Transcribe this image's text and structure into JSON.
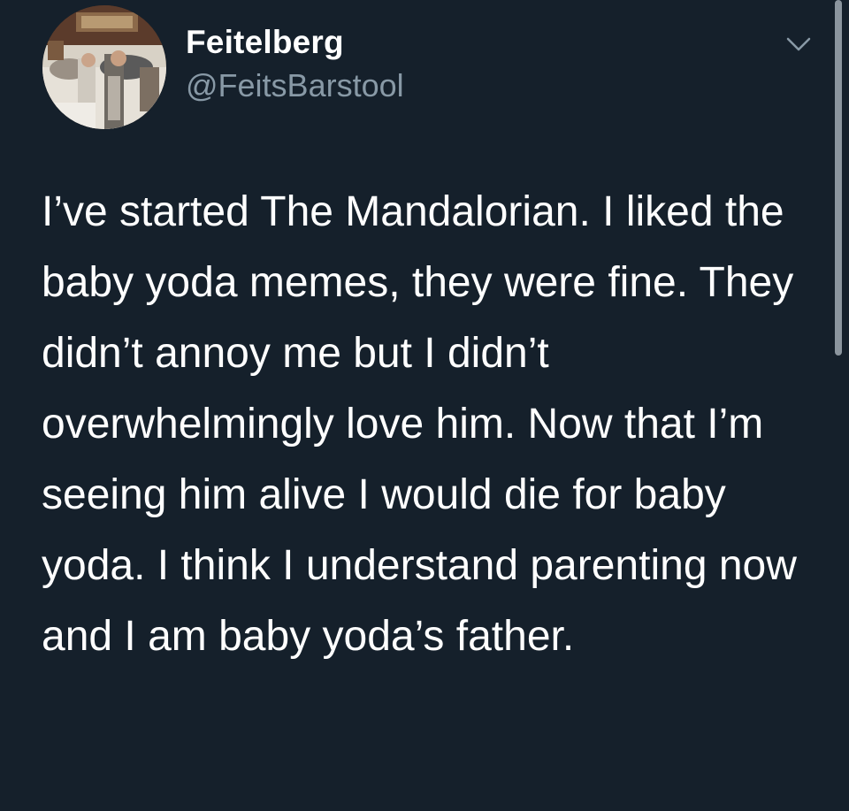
{
  "tweet": {
    "display_name": "Feitelberg",
    "handle": "@FeitsBarstool",
    "text": "I’ve started The Mandalorian. I liked the baby yoda memes, they were fine. They didn’t annoy me but I didn’t overwhelmingly love him. Now that I’m seeing him alive I would die for baby yoda. I think I understand parenting now and I am baby yoda’s father."
  },
  "icons": {
    "menu": "chevron-down-icon",
    "avatar": "profile-photo"
  },
  "colors": {
    "background": "#15202b",
    "text_primary": "#ffffff",
    "text_secondary": "#8899a6"
  }
}
